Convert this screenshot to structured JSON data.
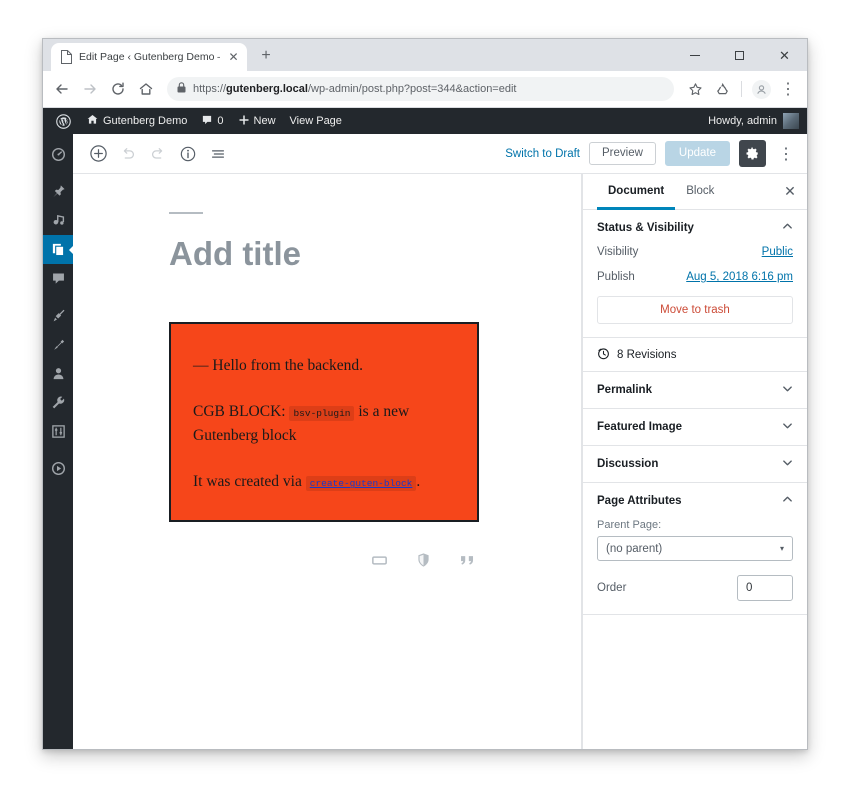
{
  "browser": {
    "tab": {
      "title": "Edit Page ‹ Gutenberg Demo — \\",
      "close_label": "✕"
    },
    "new_tab_label": "+",
    "window_controls": {
      "minimize": "–",
      "maximize": "□",
      "close": "✕"
    },
    "nav": {
      "back": "←",
      "forward": "→",
      "reload": "C",
      "home": "⌂"
    },
    "omnibox": {
      "lock": "lock-icon",
      "url_scheme": "https://",
      "url_host": "gutenberg.local",
      "url_path": "/wp-admin/post.php?post=344&action=edit",
      "full_url": "https://gutenberg.local/wp-admin/post.php?post=344&action=edit"
    },
    "toolbar_right": {
      "star": "☆",
      "extension": "recycle-icon",
      "profile": "avatar-icon",
      "menu": "⋮"
    }
  },
  "adminbar": {
    "logo": "wordpress-logo",
    "site_name": "Gutenberg Demo",
    "comments_count": "0",
    "new_label": "New",
    "view_page_label": "View Page",
    "howdy": "Howdy, admin"
  },
  "wpmenu": {
    "items": [
      {
        "name": "dashboard",
        "icon": "dashboard-icon",
        "active": false
      },
      {
        "name": "posts",
        "icon": "pin-icon",
        "active": false
      },
      {
        "name": "media",
        "icon": "media-icon",
        "active": false
      },
      {
        "name": "pages",
        "icon": "pages-icon",
        "active": true
      },
      {
        "name": "comments",
        "icon": "comment-icon",
        "active": false
      },
      {
        "name": "appearance",
        "icon": "paintbrush-icon",
        "active": false
      },
      {
        "name": "plugins",
        "icon": "plugin-icon",
        "active": false
      },
      {
        "name": "users",
        "icon": "user-icon",
        "active": false
      },
      {
        "name": "tools",
        "icon": "wrench-icon",
        "active": false
      },
      {
        "name": "settings",
        "icon": "sliders-icon",
        "active": false
      },
      {
        "name": "collapse",
        "icon": "play-circle-icon",
        "active": false
      }
    ]
  },
  "editor_toolbar": {
    "add_block": "add-block-icon",
    "undo": "undo-icon",
    "redo": "redo-icon",
    "info": "info-icon",
    "block_nav": "block-navigation-icon",
    "switch_to_draft": "Switch to Draft",
    "preview": "Preview",
    "update": "Update",
    "settings_gear": "gear-icon",
    "more_menu": "⋮"
  },
  "canvas": {
    "title_placeholder": "Add title",
    "block": {
      "line1": "— Hello from the backend.",
      "line2_prefix": "CGB BLOCK:",
      "line2_code": "bsv-plugin",
      "line2_suffix": "is a new Gutenberg block",
      "line3_prefix": "It was created via",
      "line3_code": "create-guten-block",
      "line3_suffix": ".",
      "bg_color": "#f6461a",
      "border_color": "#191e23"
    },
    "inserters": [
      {
        "name": "paragraph-block-icon",
        "glyph": "▭"
      },
      {
        "name": "shield-block-icon",
        "glyph": "🛡"
      },
      {
        "name": "quote-block-icon",
        "glyph": "❞"
      }
    ]
  },
  "settings_sidebar": {
    "tabs": [
      {
        "label": "Document",
        "active": true
      },
      {
        "label": "Block",
        "active": false
      }
    ],
    "close": "✕",
    "status_panel": {
      "title": "Status & Visibility",
      "chevron": "▲",
      "visibility_label": "Visibility",
      "visibility_value": "Public",
      "publish_label": "Publish",
      "publish_value": "Aug 5, 2018 6:16 pm",
      "trash_label": "Move to trash"
    },
    "revisions": {
      "icon": "clock-icon",
      "label": "8 Revisions"
    },
    "panels": [
      {
        "label": "Permalink",
        "chevron": "▼",
        "expanded": false
      },
      {
        "label": "Featured Image",
        "chevron": "▼",
        "expanded": false
      },
      {
        "label": "Discussion",
        "chevron": "▼",
        "expanded": false
      }
    ],
    "page_attributes": {
      "title": "Page Attributes",
      "chevron": "▲",
      "parent_label": "Parent Page:",
      "parent_value": "(no parent)",
      "caret": "▾",
      "order_label": "Order",
      "order_value": "0"
    }
  },
  "colors": {
    "wp_blue": "#0073aa",
    "tab_accent": "#0085ba",
    "admin_dark": "#23282d",
    "block_orange": "#f6461a",
    "trash_red": "#cc4b37"
  }
}
